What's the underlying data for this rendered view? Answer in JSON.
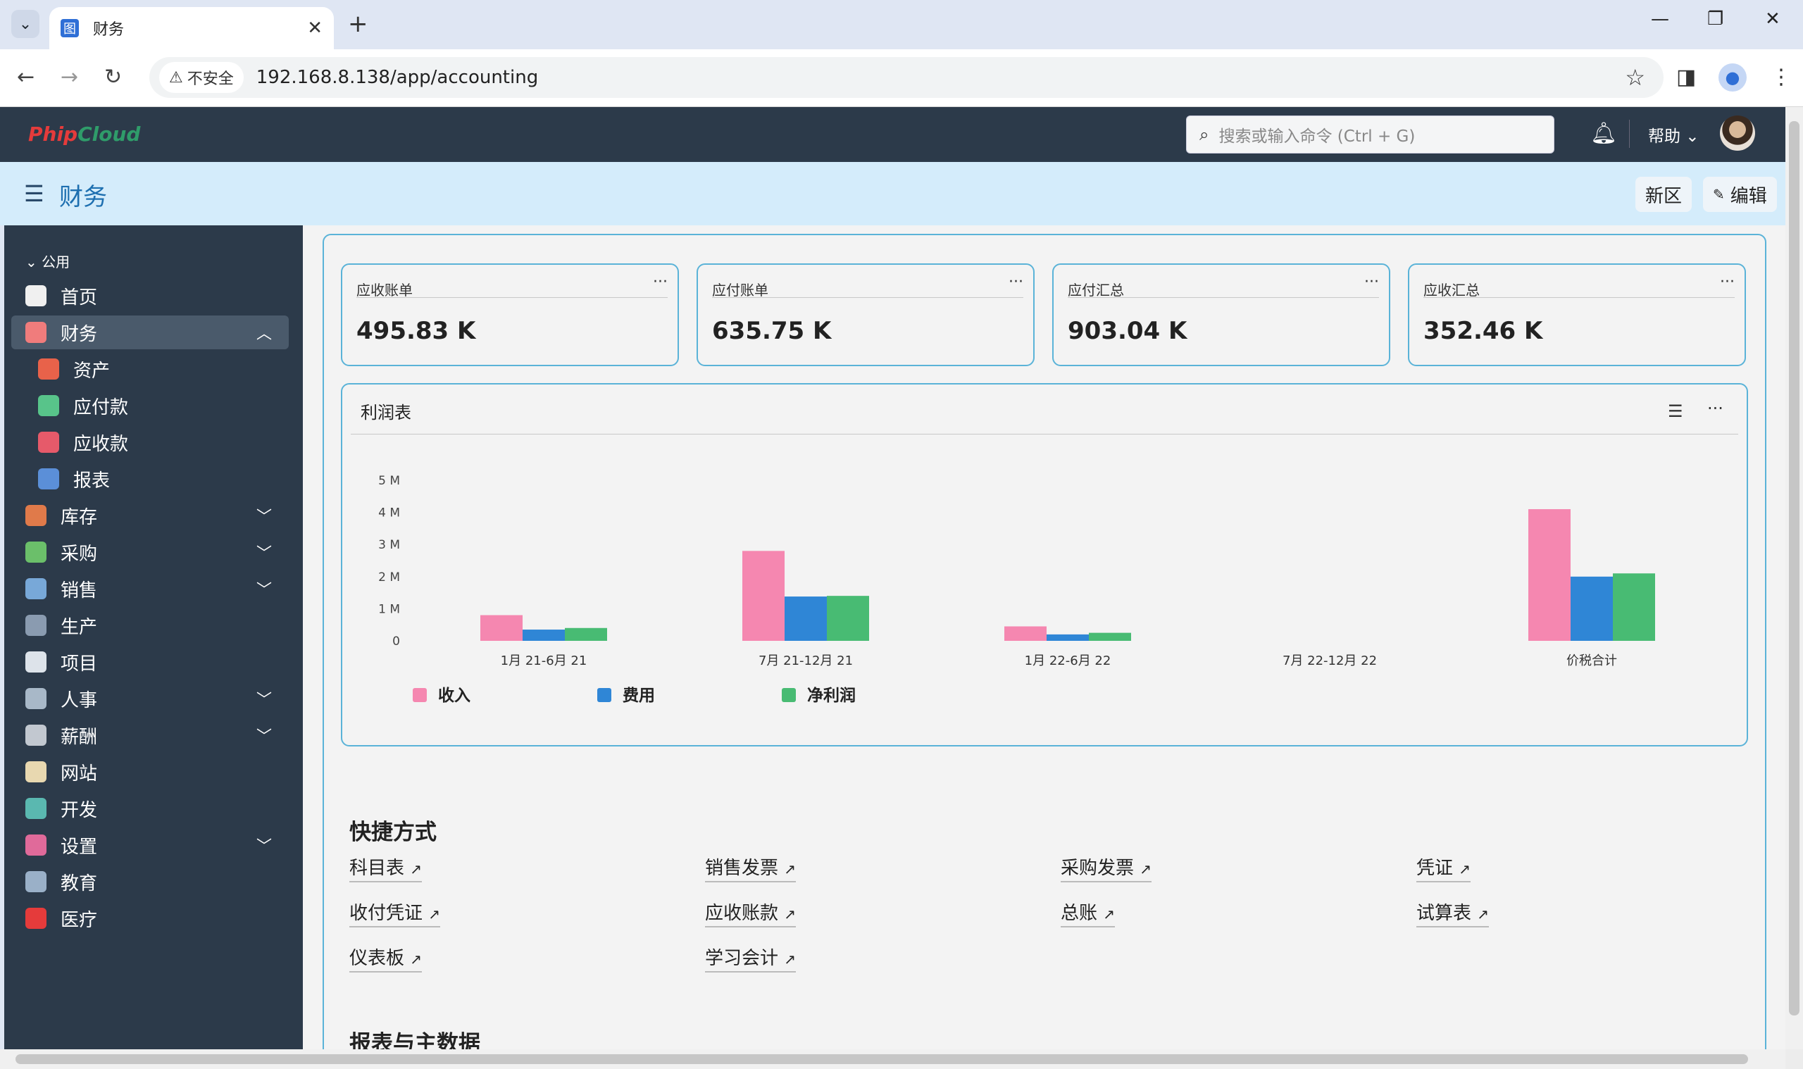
{
  "browser": {
    "tab_title": "财务",
    "favicon_text": "图",
    "insecure_label": "不安全",
    "url": "192.168.8.138/app/accounting"
  },
  "app": {
    "logo_a": "Phip",
    "logo_b": "Cloud",
    "search_placeholder": "搜索或输入命令 (Ctrl + G)",
    "help_label": "帮助"
  },
  "page": {
    "title": "财务",
    "new_workspace": "新区",
    "edit": "编辑"
  },
  "sidebar": {
    "section_label": "公用",
    "items": [
      {
        "label": "首页",
        "icon": "rocket-icon",
        "color": "#f0f0f0",
        "chev": ""
      },
      {
        "label": "财务",
        "icon": "finance-icon",
        "color": "#f07c7c",
        "chev": "︿"
      },
      {
        "label": "资产",
        "icon": "house-icon",
        "color": "#e8624a",
        "chev": ""
      },
      {
        "label": "应付款",
        "icon": "hand-money-icon",
        "color": "#58c48a",
        "chev": ""
      },
      {
        "label": "应收款",
        "icon": "hand-receive-icon",
        "color": "#e65a6a",
        "chev": ""
      },
      {
        "label": "报表",
        "icon": "report-chart-icon",
        "color": "#5b8fd8",
        "chev": ""
      },
      {
        "label": "库存",
        "icon": "warehouse-icon",
        "color": "#e07a4a",
        "chev": "﹀"
      },
      {
        "label": "采购",
        "icon": "cart-icon",
        "color": "#6bbf6a",
        "chev": "﹀"
      },
      {
        "label": "销售",
        "icon": "store-icon",
        "color": "#78a8d8",
        "chev": "﹀"
      },
      {
        "label": "生产",
        "icon": "gear-icon",
        "color": "#8a9bb0",
        "chev": ""
      },
      {
        "label": "项目",
        "icon": "project-icon",
        "color": "#dde3ea",
        "chev": ""
      },
      {
        "label": "人事",
        "icon": "people-icon",
        "color": "#a8b8c8",
        "chev": "﹀"
      },
      {
        "label": "薪酬",
        "icon": "payroll-icon",
        "color": "#c2c8d0",
        "chev": "﹀"
      },
      {
        "label": "网站",
        "icon": "website-icon",
        "color": "#e8d8b0",
        "chev": ""
      },
      {
        "label": "开发",
        "icon": "developer-icon",
        "color": "#5ab8b0",
        "chev": ""
      },
      {
        "label": "设置",
        "icon": "settings-icon",
        "color": "#e06a9a",
        "chev": "﹀"
      },
      {
        "label": "教育",
        "icon": "education-icon",
        "color": "#9ab0c8",
        "chev": ""
      },
      {
        "label": "医疗",
        "icon": "medical-cross-icon",
        "color": "#e53b3b",
        "chev": ""
      }
    ]
  },
  "cards": [
    {
      "title": "应收账单",
      "value": "495.83 K"
    },
    {
      "title": "应付账单",
      "value": "635.75 K"
    },
    {
      "title": "应付汇总",
      "value": "903.04 K"
    },
    {
      "title": "应收汇总",
      "value": "352.46 K"
    }
  ],
  "chart_title": "利润表",
  "chart_data": {
    "type": "bar",
    "categories": [
      "1月 21-6月 21",
      "7月 21-12月 21",
      "1月 22-6月 22",
      "7月 22-12月 22",
      "价税合计"
    ],
    "series": [
      {
        "name": "收入",
        "color": "#f587b0",
        "values": [
          0.8,
          2.8,
          0.45,
          0,
          4.1
        ]
      },
      {
        "name": "费用",
        "color": "#2f86d6",
        "values": [
          0.35,
          1.38,
          0.2,
          0,
          2.0
        ]
      },
      {
        "name": "净利润",
        "color": "#48bb73",
        "values": [
          0.4,
          1.4,
          0.25,
          0,
          2.1
        ]
      }
    ],
    "yticks": [
      "0",
      "1 M",
      "2 M",
      "3 M",
      "4 M",
      "5 M"
    ],
    "ylim": [
      0,
      5
    ],
    "legend": "bottom-left"
  },
  "shortcuts": {
    "title": "快捷方式",
    "links": [
      "科目表",
      "销售发票",
      "采购发票",
      "凭证",
      "收付凭证",
      "应收账款",
      "总账",
      "试算表",
      "仪表板",
      "学习会计"
    ]
  },
  "reports_title": "报表与主数据"
}
